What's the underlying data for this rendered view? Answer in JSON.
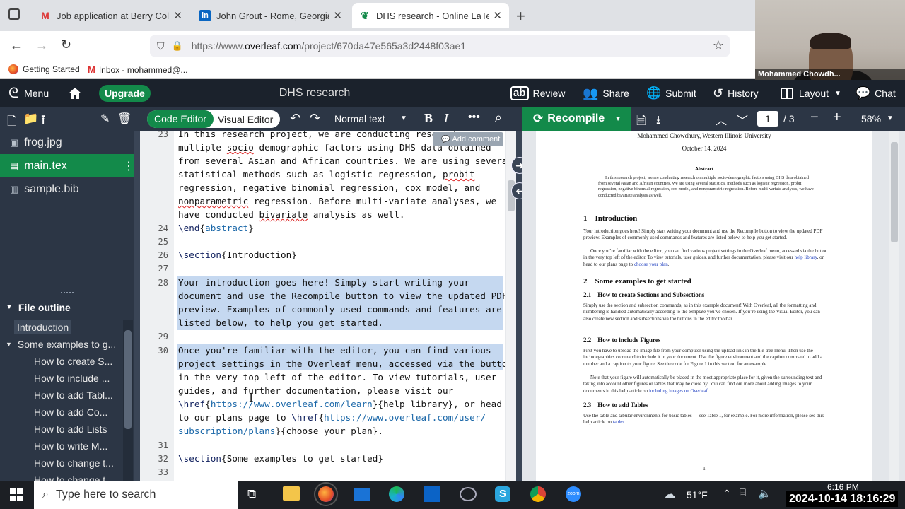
{
  "browser": {
    "tabs": [
      {
        "title": "Job application at Berry College",
        "favicon": "gmail-icon"
      },
      {
        "title": "John Grout - Rome, Georgia, Un",
        "favicon": "linkedin-icon"
      },
      {
        "title": "DHS research - Online LaTeX Ed",
        "favicon": "overleaf-icon"
      }
    ],
    "url_prefix": "https://www.",
    "url_domain": "overleaf.com",
    "url_path": "/project/670da47e565a3d2448f03ae1",
    "bookmarks": [
      "Getting Started",
      "Inbox - mohammed@..."
    ]
  },
  "webcam": {
    "name": "Mohammed Chowdh..."
  },
  "overleaf": {
    "menu": "Menu",
    "upgrade": "Upgrade",
    "project_title": "DHS research",
    "actions": {
      "review": "Review",
      "share": "Share",
      "submit": "Submit",
      "history": "History",
      "layout": "Layout",
      "chat": "Chat"
    },
    "editor_toggle": {
      "code": "Code Editor",
      "visual": "Visual Editor"
    },
    "text_style": "Normal text",
    "recompile": "Recompile",
    "page_current": "1",
    "page_total": "/ 3",
    "zoom": "58%",
    "add_comment": "Add comment"
  },
  "files": [
    {
      "name": "frog.jpg",
      "icon": "image-icon"
    },
    {
      "name": "main.tex",
      "icon": "file-icon",
      "selected": true
    },
    {
      "name": "sample.bib",
      "icon": "book-icon"
    }
  ],
  "outline": {
    "title": "File outline",
    "items": [
      {
        "label": "Introduction",
        "level": 1,
        "selected": true
      },
      {
        "label": "Some examples to g...",
        "level": 1
      },
      {
        "label": "How to create S...",
        "level": 2
      },
      {
        "label": "How to include ...",
        "level": 2
      },
      {
        "label": "How to add Tabl...",
        "level": 2
      },
      {
        "label": "How to add Co...",
        "level": 2
      },
      {
        "label": "How to add Lists",
        "level": 2
      },
      {
        "label": "How to write M...",
        "level": 2
      },
      {
        "label": "How to change t...",
        "level": 2
      },
      {
        "label": "How to change t...",
        "level": 2
      }
    ]
  },
  "editor": {
    "lines": [
      {
        "n": "23",
        "html": "In this research project, we are conducting research on",
        "t": -3
      },
      {
        "n": "",
        "html": "multiple <span class=\"sq\">socio</span>-demographic factors using DHS data obtained",
        "t": 16
      },
      {
        "n": "",
        "html": "from several Asian and African countries. We are using several",
        "t": 35
      },
      {
        "n": "",
        "html": "statistical methods such as logistic regression, <span class=\"sq\">probit</span>",
        "t": 54
      },
      {
        "n": "",
        "html": "regression, negative binomial regression, cox model, and",
        "t": 73
      },
      {
        "n": "",
        "html": "<span class=\"sq\">nonparametric</span> regression. Before multi-variate analyses, we",
        "t": 92
      },
      {
        "n": "",
        "html": "have conducted <span class=\"sq\">bivariate</span> analysis as well.",
        "t": 111
      },
      {
        "n": "24",
        "html": "<span class=\"cmd\">\\end</span>{<span class=\"kw\">abstract</span>}",
        "t": 130
      },
      {
        "n": "25",
        "html": "",
        "t": 149
      },
      {
        "n": "26",
        "html": "<span class=\"cmd\">\\section</span>{Introduction}",
        "t": 168
      },
      {
        "n": "27",
        "html": "",
        "t": 187
      },
      {
        "n": "28",
        "html": "Your introduction goes here! Simply start writing your",
        "t": 207
      },
      {
        "n": "",
        "html": "document and use the Recompile button to view the updated PDF",
        "t": 226
      },
      {
        "n": "",
        "html": "preview. Examples of commonly used commands and features are",
        "t": 245
      },
      {
        "n": "",
        "html": "listed below, to help you get started.",
        "t": 264
      },
      {
        "n": "29",
        "html": "",
        "t": 283
      },
      {
        "n": "30",
        "html": "Once you're familiar with the editor, you can find various",
        "t": 303
      },
      {
        "n": "",
        "html": "project settings in the Overleaf menu, accessed via the button",
        "t": 322
      },
      {
        "n": "",
        "html": "in the very top left of the editor. To view tutorials, user",
        "t": 341
      },
      {
        "n": "",
        "html": "guides, and further documentation, please visit our",
        "t": 360
      },
      {
        "n": "",
        "html": "<span class=\"cmd\">\\href</span>{<span class=\"kw\">https://www.overleaf.com/learn</span>}{help library}, or head",
        "t": 379
      },
      {
        "n": "",
        "html": "to our plans page to <span class=\"cmd\">\\href</span>{<span class=\"kw\">https://www.overleaf.com/user/</span>",
        "t": 398
      },
      {
        "n": "",
        "html": "<span class=\"kw\">subscription/plans</span>}{choose your plan}.",
        "t": 417
      },
      {
        "n": "31",
        "html": "",
        "t": 437
      },
      {
        "n": "32",
        "html": "<span class=\"cmd\">\\section</span>{Some examples to get started}",
        "t": 456
      },
      {
        "n": "33",
        "html": "",
        "t": 475
      }
    ]
  },
  "pdf": {
    "author_line": "Mohammed Chowdhury, Western Illinois University",
    "date": "October 14, 2024",
    "abstract_title": "Abstract",
    "abstract": "In this research project, we are conducting research on multiple socio-demographic factors using DHS data obtained from several Asian and African countries. We are using several statistical methods such as logistic regression, probit regression, negative binomial regression, cox model, and nonparametric regression. Before multi-variate analyses, we have conducted bivariate analysis as well.",
    "s1": "1    Introduction",
    "s1_p1": "Your introduction goes here! Simply start writing your document and use the Recompile button to view the updated PDF preview. Examples of commonly used commands and features are listed below, to help you get started.",
    "s1_p2a": "Once you’re familiar with the editor, you can find various project settings in the Overleaf menu, accessed via the button in the very top left of the editor. To view tutorials, user guides, and further documentation, please visit our ",
    "s1_link1": "help library",
    "s1_p2b": ", or head to our plans page to ",
    "s1_link2": "choose your plan",
    "s1_p2c": ".",
    "s2": "2    Some examples to get started",
    "s21": "2.1    How to create Sections and Subsections",
    "s21_p": "Simply use the section and subsection commands, as in this example document! With Overleaf, all the formatting and numbering is handled automatically according to the template you’ve chosen. If you’re using the Visual Editor, you can also create new section and subsections via the buttons in the editor toolbar.",
    "s22": "2.2    How to include Figures",
    "s22_p1": "First you have to upload the image file from your computer using the upload link in the file-tree menu. Then use the includegraphics command to include it in your document. Use the figure environment and the caption command to add a number and a caption to your figure. See the code for Figure 1 in this section for an example.",
    "s22_p2a": "Note that your figure will automatically be placed in the most appropriate place for it, given the surrounding text and taking into account other figures or tables that may be close by. You can find out more about adding images to your documents in this help article on ",
    "s22_link": "including images on Overleaf",
    "s22_p2b": ".",
    "s23": "2.3    How to add Tables",
    "s23_pa": "Use the table and tabular environments for basic tables — see Table 1, for example. For more information, please see this help article on ",
    "s23_link": "tables",
    "s23_pb": ".",
    "page_num": "1"
  },
  "taskbar": {
    "search_placeholder": "Type here to search",
    "weather": "51°F",
    "time": "6:16 PM",
    "date_overlay": "2024-10-14 18:16:29"
  },
  "colors": {
    "overleaf_green": "#138a4a",
    "overleaf_dark": "#1b222c",
    "toolbar": "#2c3645"
  }
}
